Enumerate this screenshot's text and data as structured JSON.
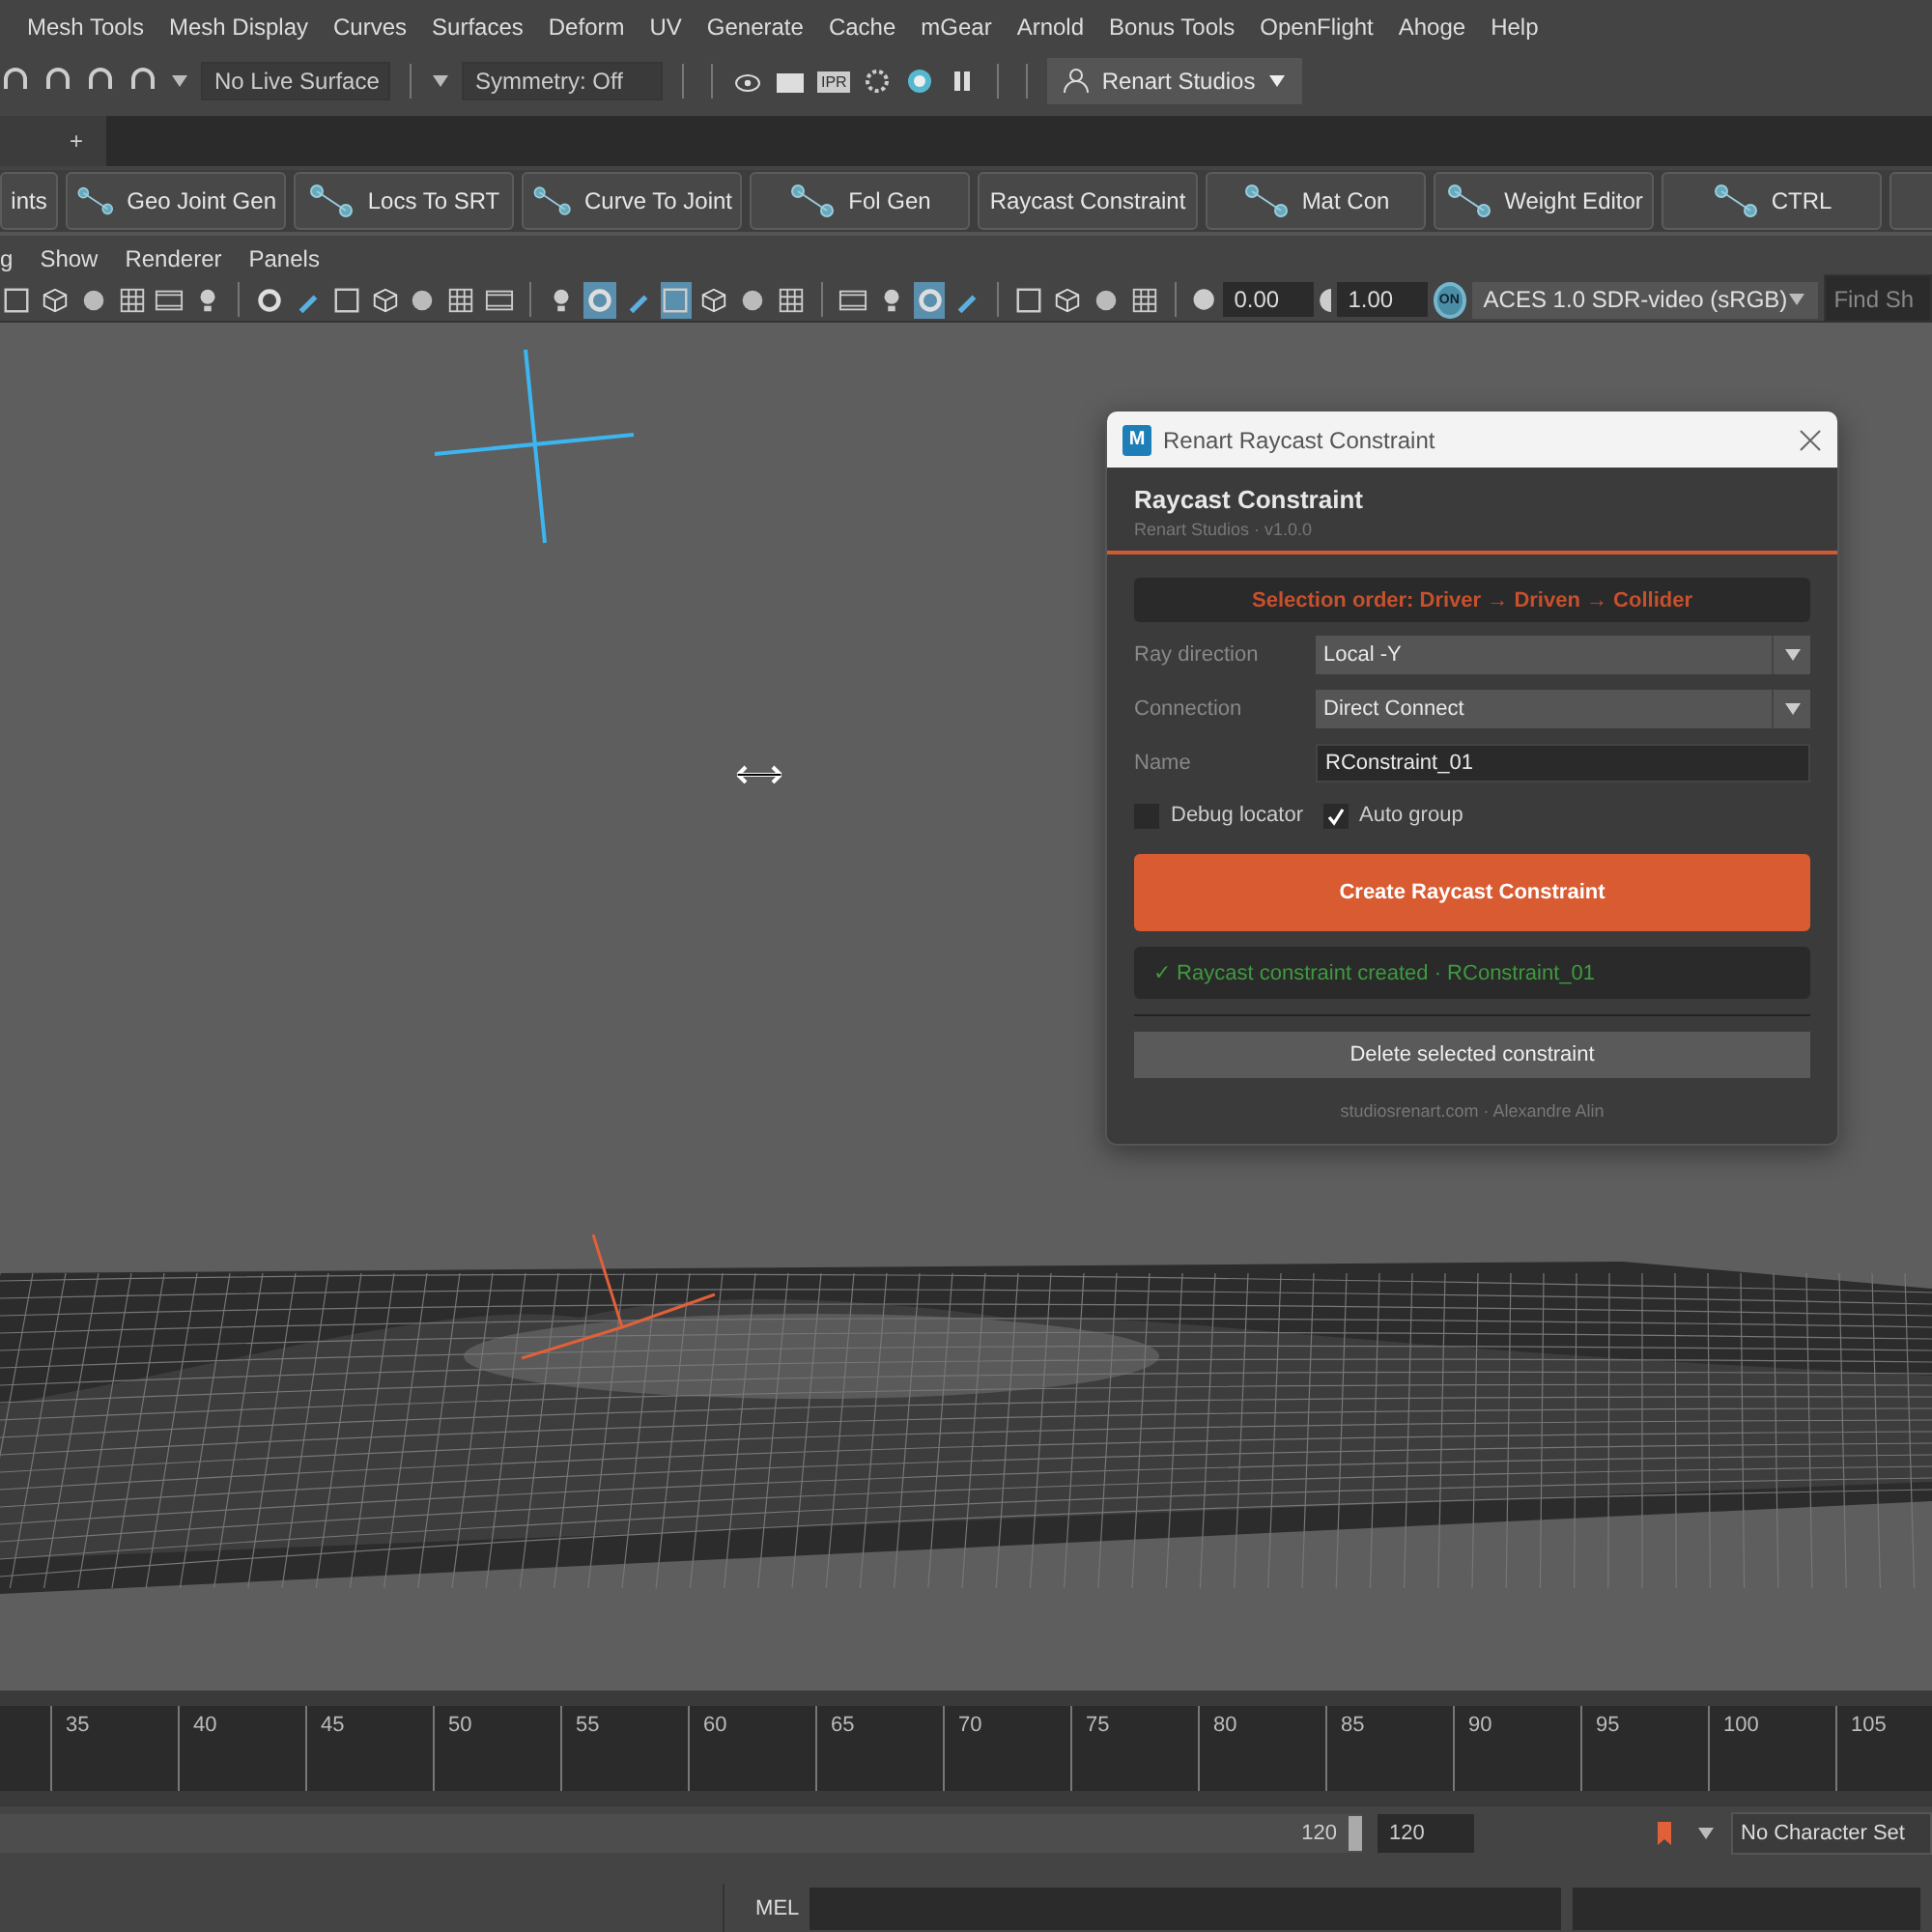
{
  "menu_bar": [
    "Mesh Tools",
    "Mesh Display",
    "Curves",
    "Surfaces",
    "Deform",
    "UV",
    "Generate",
    "Cache",
    "mGear",
    "Arnold",
    "Bonus Tools",
    "OpenFlight",
    "Ahoge",
    "Help"
  ],
  "status_line": {
    "live_surface": "No Live Surface",
    "symmetry": "Symmetry: Off",
    "ipr_label": "IPR",
    "workspace": "Renart Studios"
  },
  "shelf_tabs": {
    "add": "+"
  },
  "shelf": [
    "ints",
    "Geo Joint Gen",
    "Locs To SRT",
    "Curve To Joint",
    "Fol Gen",
    "Raycast Constraint",
    "Mat Con",
    "Weight Editor",
    "CTRL"
  ],
  "panel_menu": [
    "g",
    "Show",
    "Renderer",
    "Panels"
  ],
  "panel_toolbar": {
    "icon_groups": [
      [
        {
          "on": false
        },
        {
          "on": false
        },
        {
          "on": false
        },
        {
          "on": false
        },
        {
          "on": false
        },
        {
          "on": false
        }
      ],
      [
        {
          "on": false
        },
        {
          "on": false
        },
        {
          "on": false
        },
        {
          "on": false
        },
        {
          "on": false
        },
        {
          "on": false
        },
        {
          "on": false
        }
      ],
      [
        {
          "on": false
        },
        {
          "on": true
        },
        {
          "on": false
        },
        {
          "on": true
        },
        {
          "on": false
        },
        {
          "on": false
        },
        {
          "on": false
        }
      ],
      [
        {
          "on": false
        },
        {
          "on": false
        },
        {
          "on": true
        },
        {
          "on": false
        }
      ],
      [
        {
          "on": false
        },
        {
          "on": false
        },
        {
          "on": false
        },
        {
          "on": false
        }
      ]
    ],
    "exposure": "0.00",
    "gamma": "1.00",
    "color_management_badge": "ON",
    "view_transform": "ACES 1.0 SDR-video (sRGB)",
    "search_placeholder": "Find Sh"
  },
  "dialog": {
    "title": "Renart Raycast Constraint",
    "logo_letter": "M",
    "heading": "Raycast Constraint",
    "subtitle": "Renart Studios · v1.0.0",
    "hint": "Selection order: Driver → Driven → Collider",
    "fields": [
      {
        "kind": "dropdown",
        "label": "Ray direction",
        "value": "Local -Y"
      },
      {
        "kind": "dropdown",
        "label": "Connection",
        "value": "Direct Connect"
      },
      {
        "kind": "text",
        "label": "Name",
        "value": "RConstraint_01"
      }
    ],
    "options": [
      {
        "label": "Debug locator",
        "checked": false
      },
      {
        "label": "Auto group",
        "checked": true
      }
    ],
    "primary_button": "Create Raycast Constraint",
    "status": "✓ Raycast constraint created · RConstraint_01",
    "secondary_button": "Delete selected constraint",
    "footer": "studiosrenart.com · Alexandre Alin"
  },
  "time_slider": [
    "35",
    "40",
    "45",
    "50",
    "55",
    "60",
    "65",
    "70",
    "75",
    "80",
    "85",
    "90",
    "95",
    "100",
    "105"
  ],
  "range_slider": {
    "level": 1,
    "end": "120",
    "end_field": "120",
    "character_set": "No Character Set"
  },
  "command_line": {
    "language": "MEL"
  }
}
